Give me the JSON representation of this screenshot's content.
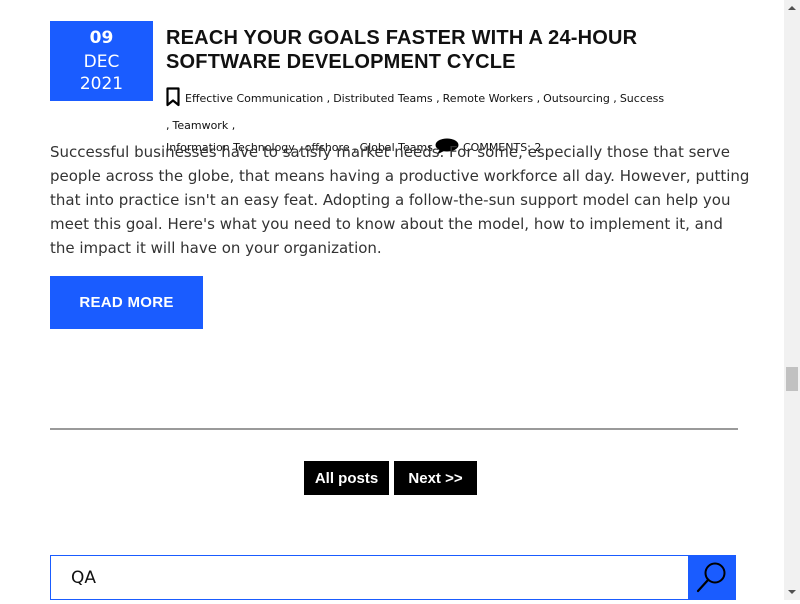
{
  "post": {
    "date": {
      "day": "09",
      "month": "DEC",
      "year": "2021"
    },
    "title_line1": "REACH YOUR GOALS FASTER WITH A 24-HOUR",
    "title_line2": "SOFTWARE DEVELOPMENT CYCLE",
    "tags": [
      "Effective Communication",
      "Distributed Teams",
      "Remote Workers",
      "Outsourcing",
      "Success",
      "Teamwork",
      "Information Technology",
      "offshore",
      "Global Teams"
    ],
    "comments_label": "COMMENTS: 2",
    "excerpt": "Successful businesses have to satisfy market needs. For some, especially those that serve people across the globe, that means having a productive workforce all day. However, putting that into practice isn't an easy feat. Adopting a follow-the-sun support model can help you meet this goal. Here's what you need to know about the model, how to implement it, and the impact it will have on your organization.",
    "read_more_label": "READ MORE"
  },
  "pagination": {
    "all_posts_label": "All posts",
    "next_label": "Next >>"
  },
  "search": {
    "value": "QA",
    "icon": "search-icon"
  },
  "colors": {
    "accent": "#1a5cff",
    "pager_bg": "#000000",
    "divider": "#9a9a9a"
  }
}
